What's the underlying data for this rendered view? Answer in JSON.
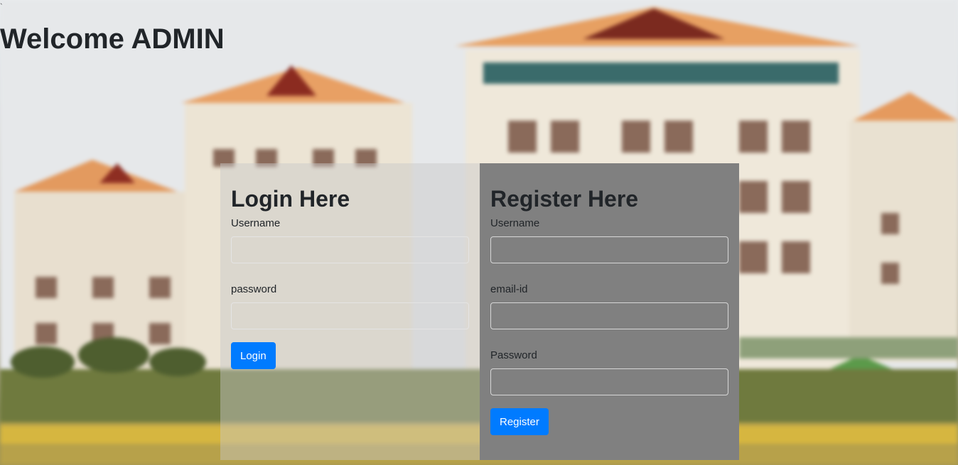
{
  "header": {
    "stray_mark": "`",
    "welcome_title": "Welcome ADMIN"
  },
  "login": {
    "title": "Login Here",
    "username_label": "Username",
    "username_value": "",
    "password_label": "password",
    "password_value": "",
    "button_label": "Login"
  },
  "register": {
    "title": "Register Here",
    "username_label": "Username",
    "username_value": "",
    "email_label": "email-id",
    "email_value": "",
    "password_label": "Password",
    "password_value": "",
    "button_label": "Register"
  },
  "colors": {
    "primary_button": "#007bff",
    "register_panel": "#808080",
    "heading_text": "#212529"
  }
}
